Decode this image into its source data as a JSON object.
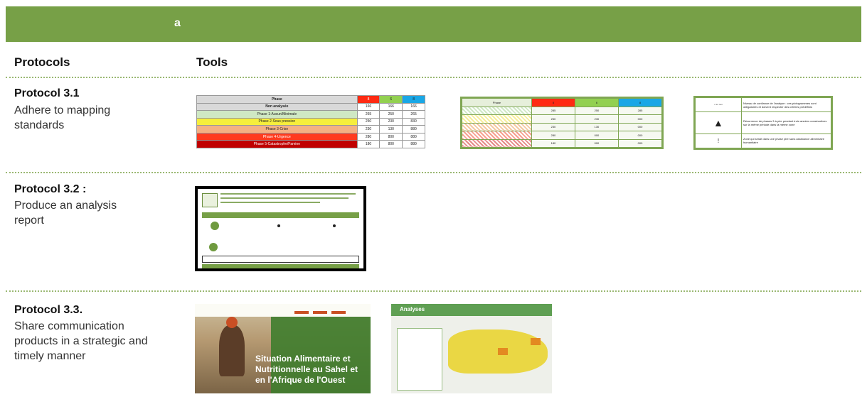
{
  "header": {
    "letter": "a"
  },
  "columns": {
    "protocols": "Protocols",
    "tools": "Tools"
  },
  "protocols": [
    {
      "title": "Protocol 3.1",
      "desc": "Adhere to mapping standards"
    },
    {
      "title": "Protocol 3.2 :",
      "desc": "Produce an analysis report"
    },
    {
      "title": "Protocol 3.3.",
      "desc": "Share communication products in a strategic and timely manner"
    }
  ],
  "thumb_phase_table": {
    "head": [
      "Phase",
      "8",
      "6",
      "8"
    ],
    "rows": [
      [
        "Non analysée",
        "166",
        "166",
        "166"
      ],
      [
        "Phase 1-Aucun/Minimale",
        "265",
        "250",
        "265"
      ],
      [
        "Phase 2-Sous pression",
        "250",
        "230",
        "830"
      ],
      [
        "Phase 3-Crise",
        "230",
        "130",
        "880"
      ],
      [
        "Phase 4-Urgence",
        "280",
        "800",
        "880"
      ],
      [
        "Phase 5-Catastrophe/Famine",
        "180",
        "800",
        "880"
      ]
    ]
  },
  "thumb_green_table": {
    "head": [
      "Phase",
      "8",
      "6",
      "8"
    ],
    "rows": [
      [
        "",
        "285",
        "250",
        "285"
      ],
      [
        "",
        "250",
        "230",
        "000"
      ],
      [
        "",
        "230",
        "130",
        "000"
      ],
      [
        "",
        "280",
        "000",
        "000"
      ],
      [
        "",
        "180",
        "000",
        "000"
      ]
    ]
  },
  "thumb_legend": {
    "rows": [
      {
        "symbol": "* ** ***",
        "text": "Niveau de confiance de l'analyse : ces pictogrammes sont obligatoires et doivent respecter des critères prédéfinis"
      },
      {
        "symbol": "▲",
        "text": "Récurrence de phases 3 à pire pendant trois années consécutives sur la même période dans la même zone"
      },
      {
        "symbol": "!",
        "text": "Zone qui serait dans une phase pire sans assistance alimentaire humanitaire"
      }
    ]
  },
  "thumb_cover": {
    "title": "Situation Alimentaire et Nutritionnelle au Sahel et en l'Afrique de l'Ouest"
  },
  "thumb_web": {
    "tab": "Analyses"
  },
  "colors": {
    "band": "#77a047",
    "dots": "#9ab872",
    "phase1": "#cfe8c4",
    "phase2": "#f6ee3c",
    "phase3": "#f4b183",
    "phase4": "#ff3b1f",
    "phase5": "#c00000"
  }
}
